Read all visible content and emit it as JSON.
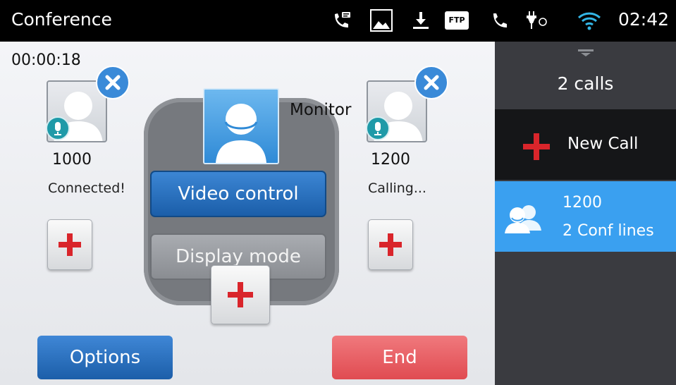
{
  "status_bar": {
    "title": "Conference",
    "time": "02:42",
    "icons": [
      "voicemail-phone-icon",
      "image-icon",
      "download-icon",
      "ftp-icon",
      "phone-icon",
      "usb-power-icon",
      "wifi-icon"
    ],
    "ftp_label": "FTP"
  },
  "conference": {
    "timer": "00:00:18",
    "host": {
      "label": "Monitor"
    },
    "parties": [
      {
        "number": "1000",
        "status": "Connected!"
      },
      {
        "number": "1200",
        "status": "Calling..."
      }
    ],
    "host_menu": {
      "video_control_label": "Video control",
      "display_mode_label": "Display mode"
    },
    "options_label": "Options",
    "end_label": "End"
  },
  "sidebar": {
    "calls_count": "2 calls",
    "new_call_label": "New Call",
    "active_call": {
      "number": "1200",
      "lines": "2 Conf lines"
    }
  },
  "colors": {
    "accent_blue": "#2f7ed0",
    "end_red": "#e85a5f",
    "add_red": "#d9252b",
    "selected_row": "#3aa0f0"
  }
}
